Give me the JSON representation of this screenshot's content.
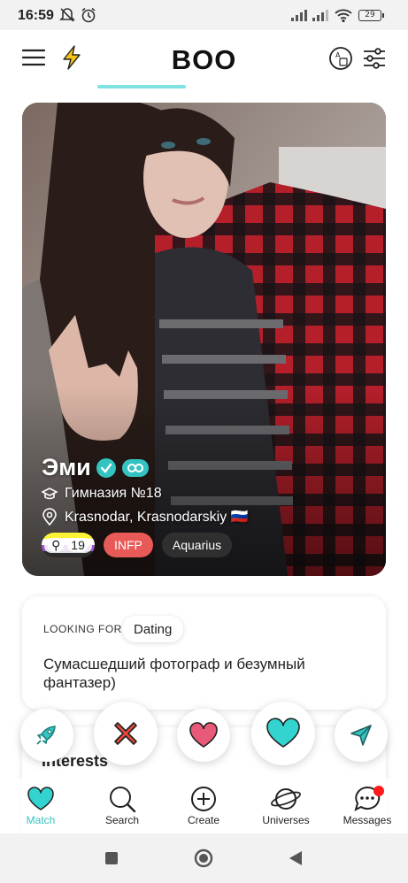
{
  "status_bar": {
    "time": "16:59",
    "battery": "29"
  },
  "header": {
    "logo": "BOO"
  },
  "profile": {
    "name": "Эми",
    "school": "Гимназия №18",
    "location": "Krasnodar, Krasnodarskiy 🇷🇺",
    "gender_badge_count": "19",
    "mbti": "INFP",
    "zodiac": "Aquarius"
  },
  "looking_for": {
    "label": "LOOKING FOR",
    "value": "Dating",
    "bio": "Сумасшедший фотограф и безумный фантазер)"
  },
  "interests": {
    "title": "Interests"
  },
  "tabs": [
    {
      "label": "Match",
      "active": true
    },
    {
      "label": "Search"
    },
    {
      "label": "Create"
    },
    {
      "label": "Universes"
    },
    {
      "label": "Messages"
    }
  ],
  "colors": {
    "accent": "#33c3c0",
    "like": "#e85a78",
    "pass": "#e8473a",
    "mbti": "#e85a58"
  }
}
